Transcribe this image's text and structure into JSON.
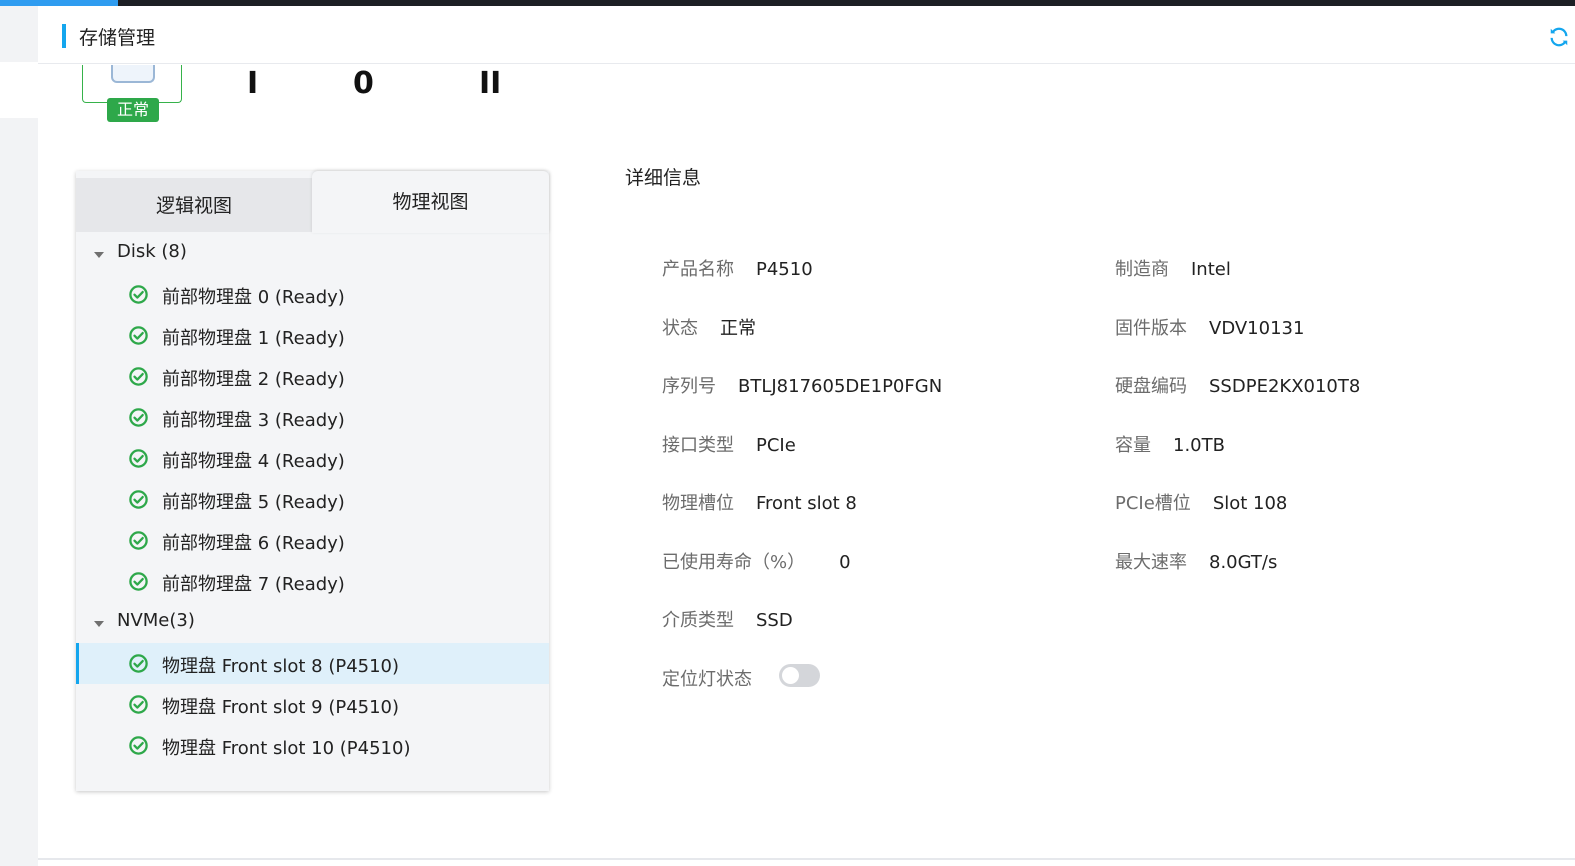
{
  "header": {
    "title": "存储管理",
    "refresh_icon": "refresh-icon"
  },
  "status_card": {
    "badge": "正常",
    "glyphs": [
      "I",
      "0",
      "II"
    ]
  },
  "tabs": [
    {
      "label": "逻辑视图",
      "active": false
    },
    {
      "label": "物理视图",
      "active": true
    }
  ],
  "tree": {
    "groups": [
      {
        "label": "Disk (8)",
        "items": [
          "前部物理盘 0 (Ready)",
          "前部物理盘 1 (Ready)",
          "前部物理盘 2 (Ready)",
          "前部物理盘 3 (Ready)",
          "前部物理盘 4 (Ready)",
          "前部物理盘 5 (Ready)",
          "前部物理盘 6 (Ready)",
          "前部物理盘 7 (Ready)"
        ]
      },
      {
        "label": "NVMe(3)",
        "items": [
          "物理盘 Front slot 8 (P4510)",
          "物理盘 Front slot 9 (P4510)",
          "物理盘 Front slot 10 (P4510)"
        ]
      }
    ],
    "selected": "物理盘 Front slot 8 (P4510)"
  },
  "details": {
    "title": "详细信息",
    "left": [
      {
        "key": "产品名称",
        "value": "P4510"
      },
      {
        "key": "状态",
        "value": "正常"
      },
      {
        "key": "序列号",
        "value": "BTLJ817605DE1P0FGN"
      },
      {
        "key": "接口类型",
        "value": "PCIe"
      },
      {
        "key": "物理槽位",
        "value": "Front slot 8"
      },
      {
        "key": "已使用寿命（%）",
        "value": "0"
      },
      {
        "key": "介质类型",
        "value": "SSD"
      }
    ],
    "right": [
      {
        "key": "制造商",
        "value": "Intel"
      },
      {
        "key": "固件版本",
        "value": "VDV10131"
      },
      {
        "key": "硬盘编码",
        "value": "SSDPE2KX010T8"
      },
      {
        "key": "容量",
        "value": "1.0TB"
      },
      {
        "key": "PCIe槽位",
        "value": "Slot 108"
      },
      {
        "key": "最大速率",
        "value": "8.0GT/s"
      }
    ],
    "locate_led": {
      "key": "定位灯状态",
      "on": false
    }
  },
  "colors": {
    "accent": "#14a6ee",
    "ok": "#2ea84a",
    "selected_row": "#dff0fa"
  }
}
